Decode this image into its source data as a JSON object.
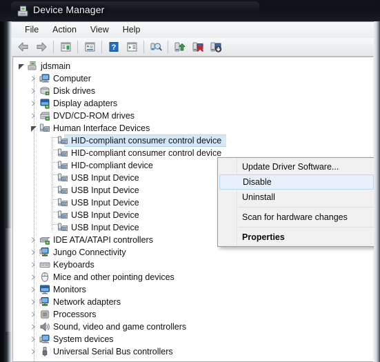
{
  "window": {
    "title": "Device Manager",
    "title_icon": "device-manager-icon"
  },
  "menubar": {
    "items": [
      {
        "label": "File",
        "name": "menu-file"
      },
      {
        "label": "Action",
        "name": "menu-action"
      },
      {
        "label": "View",
        "name": "menu-view"
      },
      {
        "label": "Help",
        "name": "menu-help"
      }
    ]
  },
  "toolbar": {
    "buttons": [
      {
        "icon": "back-arrow-icon",
        "label": "Back"
      },
      {
        "icon": "forward-arrow-icon",
        "label": "Forward"
      },
      {
        "icon": "show-hide-console-tree-icon",
        "label": "Show/Hide Console Tree"
      },
      {
        "icon": "properties-icon",
        "label": "Properties"
      },
      {
        "icon": "help-icon",
        "label": "Help"
      },
      {
        "icon": "show-hide-action-pane-icon",
        "label": "Show/Hide Action Pane"
      },
      {
        "icon": "scan-for-hardware-changes-icon",
        "label": "Scan for hardware changes"
      },
      {
        "icon": "update-driver-software-icon",
        "label": "Update Driver Software"
      },
      {
        "icon": "disable-device-icon",
        "label": "Disable"
      },
      {
        "icon": "enable-device-icon",
        "label": "Enable"
      }
    ]
  },
  "tree": {
    "root": {
      "label": "jdsmain",
      "icon": "computer-node-icon",
      "expanded": true
    },
    "nodes": [
      {
        "label": "Computer",
        "icon": "computer-icon",
        "level": 1,
        "expanded": false
      },
      {
        "label": "Disk drives",
        "icon": "disk-drive-icon",
        "level": 1,
        "expanded": false
      },
      {
        "label": "Display adapters",
        "icon": "display-adapter-icon",
        "level": 1,
        "expanded": false
      },
      {
        "label": "DVD/CD-ROM drives",
        "icon": "dvd-drive-icon",
        "level": 1,
        "expanded": false
      },
      {
        "label": "Human Interface Devices",
        "icon": "hid-icon",
        "level": 1,
        "expanded": true
      },
      {
        "label": "HID-compliant consumer control device",
        "icon": "hid-device-icon",
        "level": 2,
        "leaf": true,
        "selected": true
      },
      {
        "label": "HID-compliant consumer control device",
        "icon": "hid-device-icon",
        "level": 2,
        "leaf": true
      },
      {
        "label": "HID-compliant device",
        "icon": "hid-device-icon",
        "level": 2,
        "leaf": true
      },
      {
        "label": "USB Input Device",
        "icon": "hid-device-icon",
        "level": 2,
        "leaf": true
      },
      {
        "label": "USB Input Device",
        "icon": "hid-device-icon",
        "level": 2,
        "leaf": true
      },
      {
        "label": "USB Input Device",
        "icon": "hid-device-icon",
        "level": 2,
        "leaf": true
      },
      {
        "label": "USB Input Device",
        "icon": "hid-device-icon",
        "level": 2,
        "leaf": true
      },
      {
        "label": "USB Input Device",
        "icon": "hid-device-icon",
        "level": 2,
        "leaf": true
      },
      {
        "label": "IDE ATA/ATAPI controllers",
        "icon": "ide-controller-icon",
        "level": 1,
        "expanded": false
      },
      {
        "label": "Jungo Connectivity",
        "icon": "network-icon",
        "level": 1,
        "expanded": false
      },
      {
        "label": "Keyboards",
        "icon": "keyboard-icon",
        "level": 1,
        "expanded": false
      },
      {
        "label": "Mice and other pointing devices",
        "icon": "mouse-icon",
        "level": 1,
        "expanded": false
      },
      {
        "label": "Monitors",
        "icon": "monitor-icon",
        "level": 1,
        "expanded": false
      },
      {
        "label": "Network adapters",
        "icon": "network-icon",
        "level": 1,
        "expanded": false
      },
      {
        "label": "Processors",
        "icon": "processor-icon",
        "level": 1,
        "expanded": false
      },
      {
        "label": "Sound, video and game controllers",
        "icon": "speaker-icon",
        "level": 1,
        "expanded": false
      },
      {
        "label": "System devices",
        "icon": "computer-icon",
        "level": 1,
        "expanded": false
      },
      {
        "label": "Universal Serial Bus controllers",
        "icon": "usb-icon",
        "level": 1,
        "expanded": false
      }
    ]
  },
  "context_menu": {
    "items": [
      {
        "label": "Update Driver Software...",
        "type": "item",
        "highlighted": false,
        "bold": false
      },
      {
        "label": "Disable",
        "type": "item",
        "highlighted": true,
        "bold": false
      },
      {
        "label": "Uninstall",
        "type": "item",
        "highlighted": false,
        "bold": false
      },
      {
        "type": "separator"
      },
      {
        "label": "Scan for hardware changes",
        "type": "item",
        "highlighted": false,
        "bold": false
      },
      {
        "type": "separator"
      },
      {
        "label": "Properties",
        "type": "item",
        "highlighted": false,
        "bold": true
      }
    ]
  },
  "colors": {
    "selection": "#d4e8f7",
    "menu_highlight": "#e8f1fb",
    "titlebar": "#0e1118",
    "client_bg": "#f0f0f0"
  }
}
